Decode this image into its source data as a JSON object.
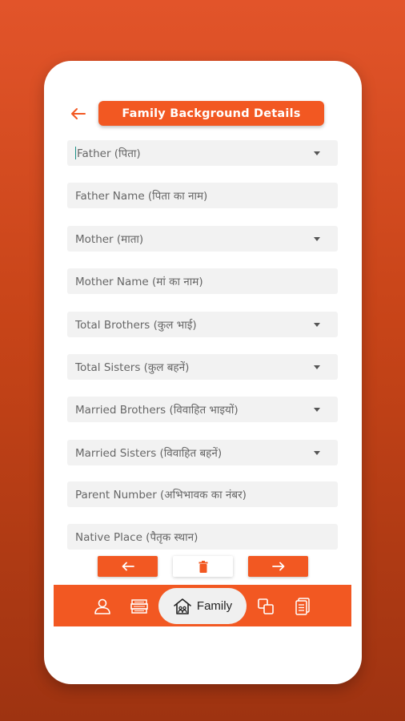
{
  "header": {
    "title": "Family Background Details"
  },
  "fields": [
    {
      "label": "Father (पिता)",
      "type": "dropdown"
    },
    {
      "label": "Father Name (पिता का नाम)",
      "type": "text"
    },
    {
      "label": "Mother (माता)",
      "type": "dropdown"
    },
    {
      "label": "Mother Name (मां का नाम)",
      "type": "text"
    },
    {
      "label": "Total Brothers (कुल भाई)",
      "type": "dropdown"
    },
    {
      "label": "Total Sisters (कुल बहनें)",
      "type": "dropdown"
    },
    {
      "label": "Married Brothers (विवाहित भाइयों)",
      "type": "dropdown"
    },
    {
      "label": "Married Sisters (विवाहित बहनें)",
      "type": "dropdown"
    },
    {
      "label": "Parent Number (अभिभावक का नंबर)",
      "type": "text"
    },
    {
      "label": "Native Place (पैतृक स्थान)",
      "type": "text"
    }
  ],
  "tabbar": {
    "active_label": "Family",
    "icons": [
      "person-icon",
      "education-icon",
      "family-home-icon",
      "copy-icon",
      "documents-icon"
    ]
  },
  "colors": {
    "accent": "#f25822",
    "background_top": "#e2542a",
    "background_bottom": "#9e3311",
    "field_bg": "#f2f2f2"
  }
}
